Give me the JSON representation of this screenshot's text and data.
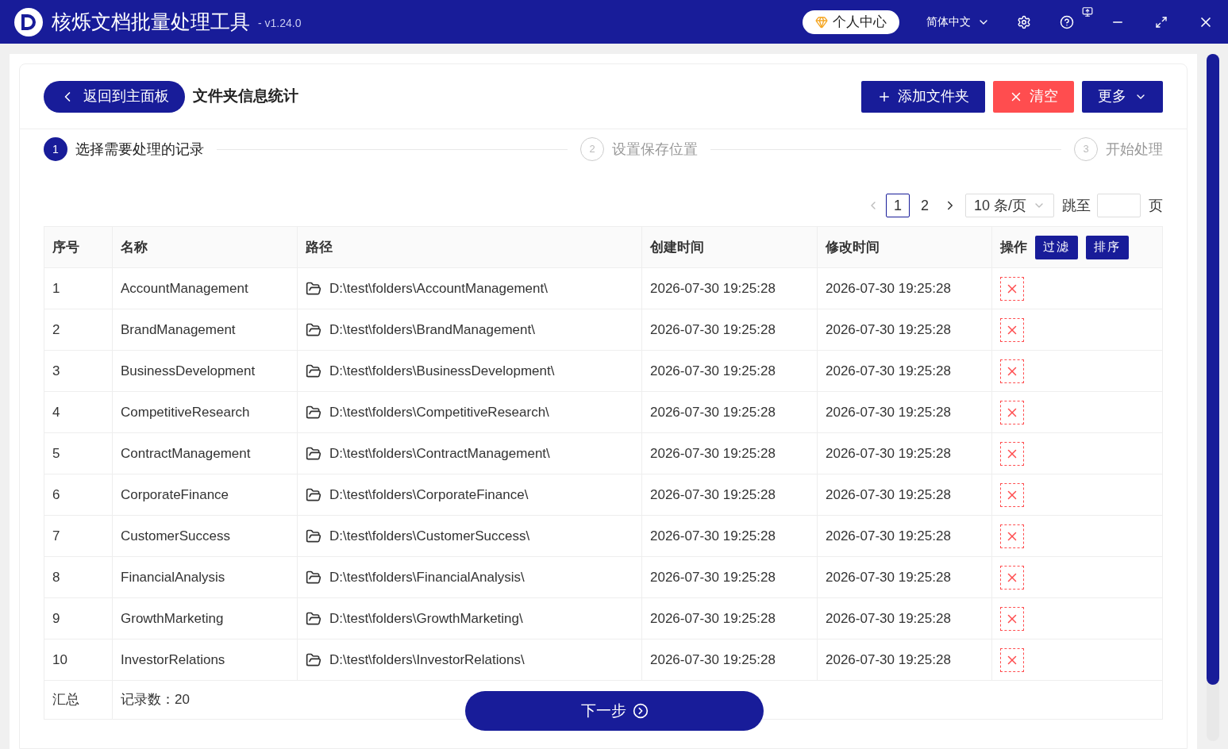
{
  "app": {
    "title": "核烁文档批量处理工具",
    "version": "- v1.24.0",
    "user_center": "个人中心",
    "language": "简体中文"
  },
  "toolbar": {
    "back": "返回到主面板",
    "page_title": "文件夹信息统计",
    "add": "添加文件夹",
    "clear": "清空",
    "more": "更多"
  },
  "steps": [
    {
      "number": "1",
      "label": "选择需要处理的记录",
      "selected": true
    },
    {
      "number": "2",
      "label": "设置保存位置",
      "selected": false
    },
    {
      "number": "3",
      "label": "开始处理",
      "selected": false
    }
  ],
  "pagination": {
    "pages": [
      {
        "label": "1",
        "selected": true
      },
      {
        "label": "2",
        "selected": false
      }
    ],
    "page_size": "10 条/页",
    "jump_label": "跳至",
    "page_suffix": "页"
  },
  "table": {
    "columns": [
      "序号",
      "名称",
      "路径",
      "创建时间",
      "修改时间",
      "操作"
    ],
    "header_buttons": [
      "过滤",
      "排序"
    ],
    "rows": [
      {
        "index": "1",
        "name": "AccountManagement",
        "path": "D:\\test\\folders\\AccountManagement\\",
        "created": "2026-07-30 19:25:28",
        "modified": "2026-07-30 19:25:28"
      },
      {
        "index": "2",
        "name": "BrandManagement",
        "path": "D:\\test\\folders\\BrandManagement\\",
        "created": "2026-07-30 19:25:28",
        "modified": "2026-07-30 19:25:28"
      },
      {
        "index": "3",
        "name": "BusinessDevelopment",
        "path": "D:\\test\\folders\\BusinessDevelopment\\",
        "created": "2026-07-30 19:25:28",
        "modified": "2026-07-30 19:25:28"
      },
      {
        "index": "4",
        "name": "CompetitiveResearch",
        "path": "D:\\test\\folders\\CompetitiveResearch\\",
        "created": "2026-07-30 19:25:28",
        "modified": "2026-07-30 19:25:28"
      },
      {
        "index": "5",
        "name": "ContractManagement",
        "path": "D:\\test\\folders\\ContractManagement\\",
        "created": "2026-07-30 19:25:28",
        "modified": "2026-07-30 19:25:28"
      },
      {
        "index": "6",
        "name": "CorporateFinance",
        "path": "D:\\test\\folders\\CorporateFinance\\",
        "created": "2026-07-30 19:25:28",
        "modified": "2026-07-30 19:25:28"
      },
      {
        "index": "7",
        "name": "CustomerSuccess",
        "path": "D:\\test\\folders\\CustomerSuccess\\",
        "created": "2026-07-30 19:25:28",
        "modified": "2026-07-30 19:25:28"
      },
      {
        "index": "8",
        "name": "FinancialAnalysis",
        "path": "D:\\test\\folders\\FinancialAnalysis\\",
        "created": "2026-07-30 19:25:28",
        "modified": "2026-07-30 19:25:28"
      },
      {
        "index": "9",
        "name": "GrowthMarketing",
        "path": "D:\\test\\folders\\GrowthMarketing\\",
        "created": "2026-07-30 19:25:28",
        "modified": "2026-07-30 19:25:28"
      },
      {
        "index": "10",
        "name": "InvestorRelations",
        "path": "D:\\test\\folders\\InvestorRelations\\",
        "created": "2026-07-30 19:25:28",
        "modified": "2026-07-30 19:25:28"
      }
    ],
    "summary": {
      "label": "汇总",
      "count": "记录数：20"
    }
  },
  "next_button": "下一步"
}
